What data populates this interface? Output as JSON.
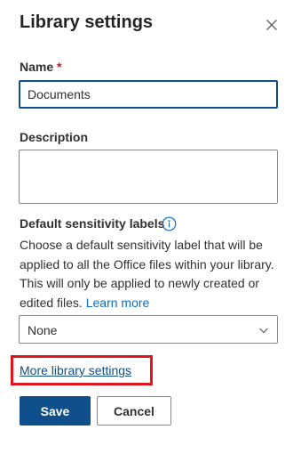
{
  "panel": {
    "title": "Library settings",
    "close_icon": "close-icon"
  },
  "name": {
    "label": "Name",
    "required_mark": "*",
    "value": "Documents"
  },
  "description": {
    "label": "Description",
    "value": ""
  },
  "sensitivity": {
    "label": "Default sensitivity labels",
    "info_icon": "info-icon",
    "help_text": "Choose a default sensitivity label that will be applied to all the Office files within your library. This will only be applied to newly created or edited files.",
    "learn_more": "Learn more",
    "selected": "None",
    "dropdown_icon": "chevron-down-icon"
  },
  "more_settings_link": "More library settings",
  "highlight_color": "#e3141b",
  "accent_color": "#0f4f8c",
  "buttons": {
    "save": "Save",
    "cancel": "Cancel"
  }
}
